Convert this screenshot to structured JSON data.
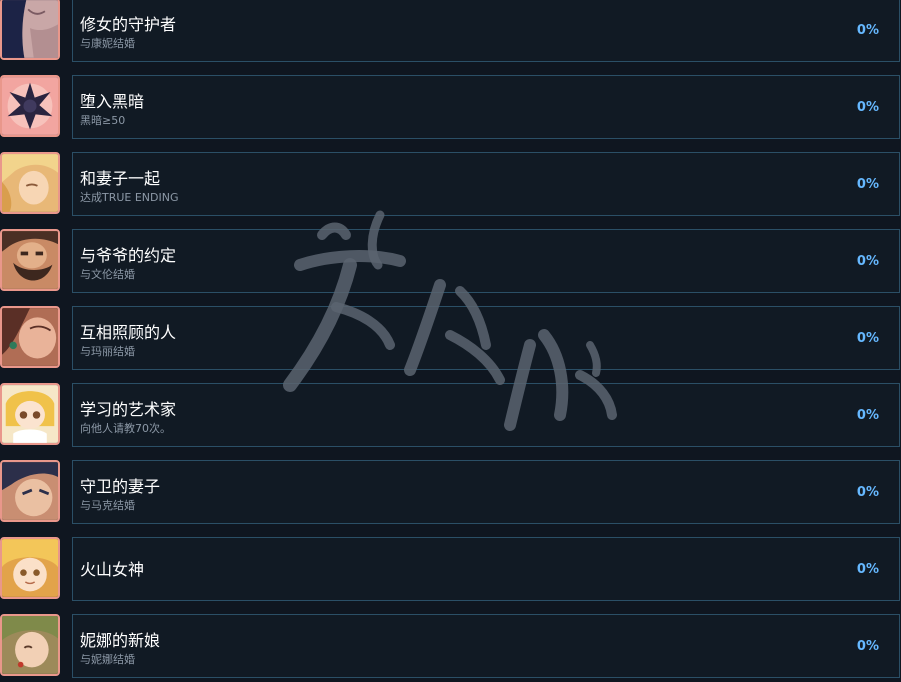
{
  "achievements": [
    {
      "title": "修女的守护者",
      "desc": "与康妮结婚",
      "percent": "0%",
      "icon": "nun-portrait-icon"
    },
    {
      "title": "堕入黑暗",
      "desc": "黑暗≥50",
      "percent": "0%",
      "icon": "dark-star-icon"
    },
    {
      "title": "和妻子一起",
      "desc": "达成TRUE ENDING",
      "percent": "0%",
      "icon": "blonde-wife-portrait-icon"
    },
    {
      "title": "与爷爷的约定",
      "desc": "与文伦结婚",
      "percent": "0%",
      "icon": "bearded-man-portrait-icon"
    },
    {
      "title": "互相照顾的人",
      "desc": "与玛丽结婚",
      "percent": "0%",
      "icon": "woman-earring-portrait-icon"
    },
    {
      "title": "学习的艺术家",
      "desc": "向他人请教70次。",
      "percent": "0%",
      "icon": "blonde-girl-portrait-icon"
    },
    {
      "title": "守卫的妻子",
      "desc": "与马克结婚",
      "percent": "0%",
      "icon": "dark-hair-man-portrait-icon"
    },
    {
      "title": "火山女神",
      "desc": "",
      "percent": "0%",
      "icon": "golden-hair-girl-portrait-icon"
    },
    {
      "title": "妮娜的新娘",
      "desc": "与妮娜结婚",
      "percent": "0%",
      "icon": "green-hair-girl-portrait-icon"
    }
  ],
  "colors": {
    "background": "#0f1620",
    "panel_border": "#2b4f66",
    "icon_frame": "#e9978b",
    "percent": "#66b8ff"
  }
}
